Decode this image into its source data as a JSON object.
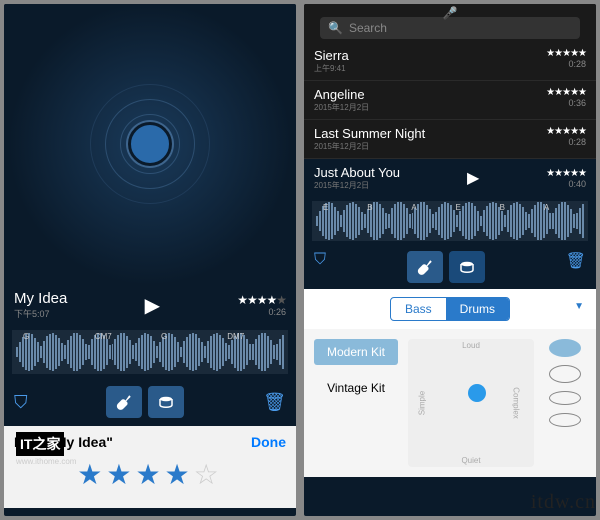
{
  "watermark": "itdw.cn",
  "it_badge": "IT之家",
  "it_url": "www.ithome.com",
  "screen1": {
    "title": "My Idea",
    "time": "下午5:07",
    "stars_filled": 4,
    "stars_total": 5,
    "duration": "0:26",
    "chords": [
      "G",
      "CM7",
      "G",
      "DM7"
    ],
    "rate_prompt": "Rate \"My Idea\"",
    "done_label": "Done",
    "rate_stars_filled": 4,
    "rate_stars_total": 5
  },
  "screen2": {
    "search_placeholder": "Search",
    "songs": [
      {
        "name": "Sierra",
        "date": "上午9:41",
        "stars": 5,
        "duration": "0:28"
      },
      {
        "name": "Angeline",
        "date": "2015年12月2日",
        "stars": 5,
        "duration": "0:36"
      },
      {
        "name": "Last Summer Night",
        "date": "2015年12月2日",
        "stars": 5,
        "duration": "0:28"
      }
    ],
    "selected": {
      "name": "Just About You",
      "date": "2015年12月2日",
      "stars": 5,
      "duration": "0:40"
    },
    "chords": [
      "E",
      "B",
      "A",
      "E",
      "B",
      "A"
    ],
    "segments": [
      "Bass",
      "Drums"
    ],
    "segment_active": "Drums",
    "kits": [
      "Modern Kit",
      "Vintage Kit"
    ],
    "kit_active": "Modern Kit",
    "pad_labels": {
      "top": "Loud",
      "bottom": "Quiet",
      "left": "Simple",
      "right": "Complex"
    }
  }
}
